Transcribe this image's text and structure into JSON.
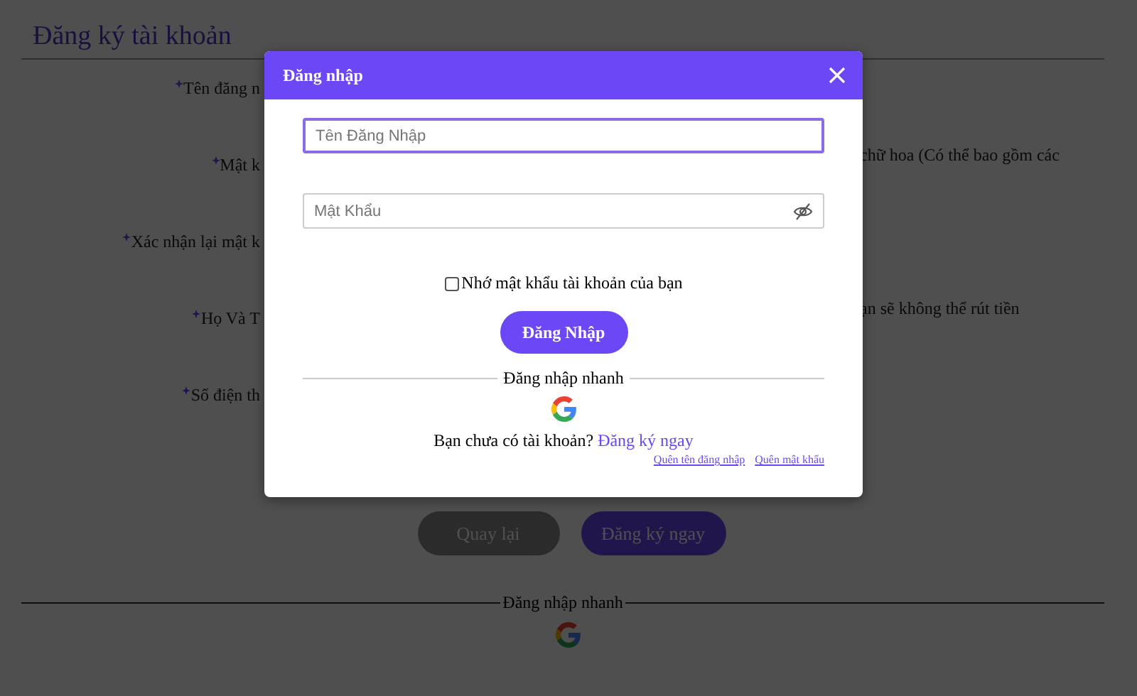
{
  "page": {
    "title": "Đăng ký tài khoản",
    "form_rows": [
      {
        "label": "Tên đăng n",
        "required": true
      },
      {
        "label": "Mật k",
        "required": true,
        "hint": "chữ hoa (Có thể bao gồm các"
      },
      {
        "label": "Xác nhận lại mật k",
        "required": true
      },
      {
        "label": "Họ Và T",
        "required": true,
        "hint": "ạn sẽ không thể rút tiền"
      },
      {
        "label": "Số điện th",
        "required": true
      }
    ],
    "buttons": [
      {
        "label": "Quay lại",
        "kind": "secondary"
      },
      {
        "label": "Đăng ký ngay",
        "kind": "primary"
      }
    ],
    "quick_login": "Đăng nhập nhanh"
  },
  "dialog": {
    "title": "Đăng nhập",
    "username": {
      "placeholder": "Tên Đăng Nhập",
      "focused": true
    },
    "password": {
      "placeholder": "Mật Khẩu",
      "focused": false
    },
    "remember": {
      "label": "Nhớ mật khẩu tài khoản của bạn",
      "checked": false
    },
    "submit": "Đăng Nhập",
    "quick_login": "Đăng nhập nhanh",
    "signup_prompt": "Bạn chưa có tài khoản?",
    "signup_link": "Đăng ký ngay",
    "links": [
      "Quên tên đăng nhập",
      "Quên mật khẩu"
    ]
  }
}
